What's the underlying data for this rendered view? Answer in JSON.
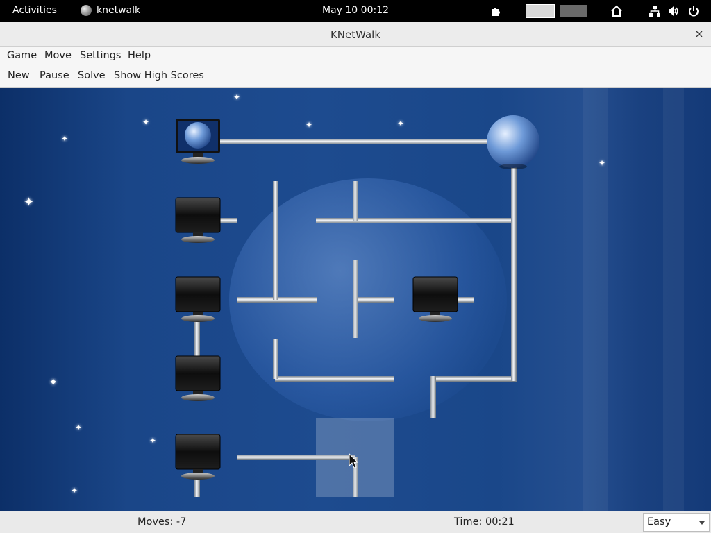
{
  "topbar": {
    "activities": "Activities",
    "app_name": "knetwalk",
    "clock": "May 10  00:12"
  },
  "window": {
    "title": "KNetWalk",
    "close_label": "×"
  },
  "menu": {
    "game": "Game",
    "move": "Move",
    "settings": "Settings",
    "help": "Help"
  },
  "toolbar": {
    "new": "New",
    "pause": "Pause",
    "solve": "Solve",
    "high_scores": "Show High Scores"
  },
  "status": {
    "moves": "Moves: -7",
    "time": "Time: 00:21",
    "difficulty": "Easy"
  }
}
